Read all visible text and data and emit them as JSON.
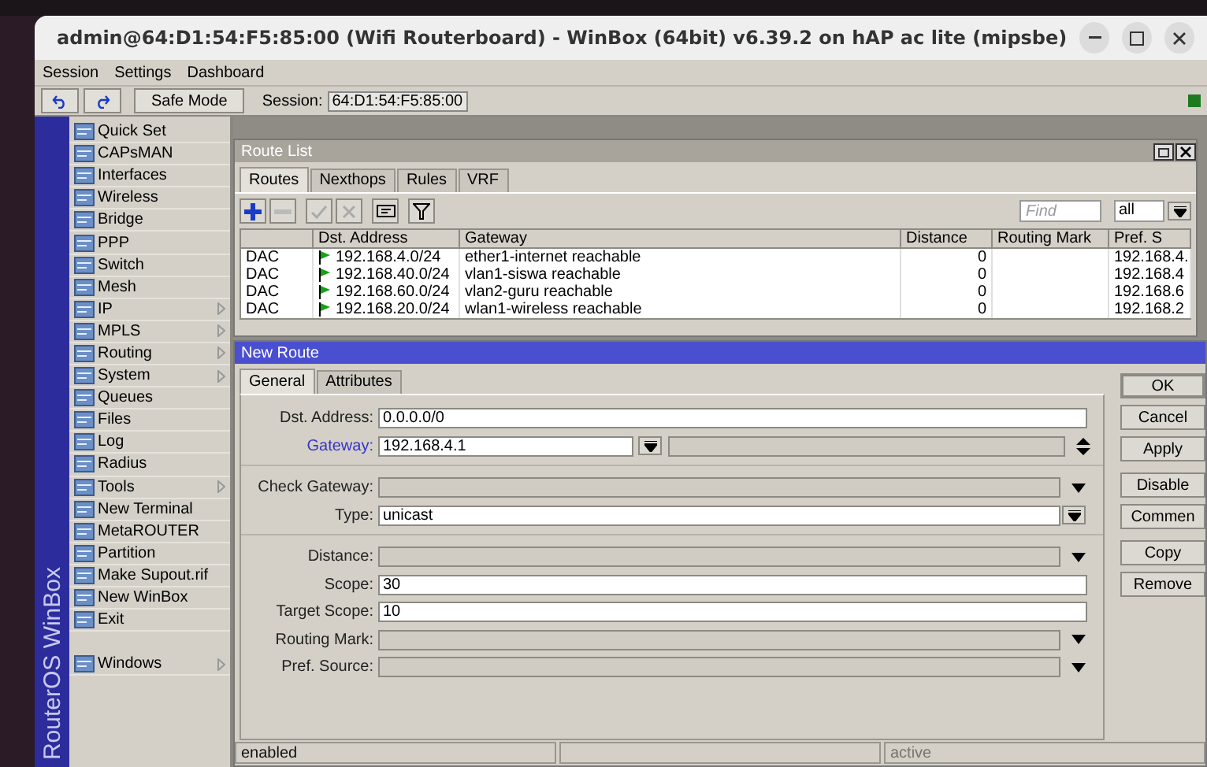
{
  "window": {
    "title": "admin@64:D1:54:F5:85:00 (Wifi Routerboard) - WinBox (64bit) v6.39.2 on hAP ac lite (mipsbe)"
  },
  "menu": [
    "Session",
    "Settings",
    "Dashboard"
  ],
  "toolbar": {
    "safe_mode": "Safe Mode",
    "session_label": "Session:",
    "session_value": "64:D1:54:F5:85:00"
  },
  "sidebar": {
    "brand": "RouterOS WinBox",
    "items": [
      {
        "label": "Quick Set",
        "submenu": false
      },
      {
        "label": "CAPsMAN",
        "submenu": false
      },
      {
        "label": "Interfaces",
        "submenu": false
      },
      {
        "label": "Wireless",
        "submenu": false
      },
      {
        "label": "Bridge",
        "submenu": false
      },
      {
        "label": "PPP",
        "submenu": false
      },
      {
        "label": "Switch",
        "submenu": false
      },
      {
        "label": "Mesh",
        "submenu": false
      },
      {
        "label": "IP",
        "submenu": true
      },
      {
        "label": "MPLS",
        "submenu": true
      },
      {
        "label": "Routing",
        "submenu": true
      },
      {
        "label": "System",
        "submenu": true
      },
      {
        "label": "Queues",
        "submenu": false
      },
      {
        "label": "Files",
        "submenu": false
      },
      {
        "label": "Log",
        "submenu": false
      },
      {
        "label": "Radius",
        "submenu": false
      },
      {
        "label": "Tools",
        "submenu": true
      },
      {
        "label": "New Terminal",
        "submenu": false
      },
      {
        "label": "MetaROUTER",
        "submenu": false
      },
      {
        "label": "Partition",
        "submenu": false
      },
      {
        "label": "Make Supout.rif",
        "submenu": false
      },
      {
        "label": "New WinBox",
        "submenu": false
      },
      {
        "label": "Exit",
        "submenu": false
      }
    ],
    "footer_items": [
      {
        "label": "Windows",
        "submenu": true
      }
    ]
  },
  "route_list": {
    "title": "Route List",
    "tabs": [
      {
        "label": "Routes",
        "selected": true
      },
      {
        "label": "Nexthops",
        "selected": false
      },
      {
        "label": "Rules",
        "selected": false
      },
      {
        "label": "VRF",
        "selected": false
      }
    ],
    "tools": [
      {
        "kind": "add",
        "disabled": false
      },
      {
        "kind": "remove",
        "disabled": true
      },
      {
        "kind": "enable",
        "disabled": true
      },
      {
        "kind": "disable",
        "disabled": true
      },
      {
        "kind": "comment",
        "disabled": false
      },
      {
        "kind": "filter",
        "disabled": false
      }
    ],
    "find_placeholder": "Find",
    "filter_value": "all",
    "columns": [
      "Dst. Address",
      "Gateway",
      "Distance",
      "Routing Mark",
      "Pref. S"
    ],
    "rows": [
      {
        "type": "DAC",
        "dst": "192.168.4.0/24",
        "gateway": "ether1-internet reachable",
        "distance": "0",
        "pref_source": "192.168.4."
      },
      {
        "type": "DAC",
        "dst": "192.168.40.0/24",
        "gateway": "vlan1-siswa reachable",
        "distance": "0",
        "pref_source": "192.168.4"
      },
      {
        "type": "DAC",
        "dst": "192.168.60.0/24",
        "gateway": "vlan2-guru reachable",
        "distance": "0",
        "pref_source": "192.168.6"
      },
      {
        "type": "DAC",
        "dst": "192.168.20.0/24",
        "gateway": "wlan1-wireless reachable",
        "distance": "0",
        "pref_source": "192.168.2"
      }
    ]
  },
  "new_route": {
    "title": "New Route",
    "tabs": [
      {
        "label": "General",
        "selected": true
      },
      {
        "label": "Attributes",
        "selected": false
      }
    ],
    "field_groups": [
      [
        {
          "label": "Dst. Address:",
          "kind": "text",
          "value": "0.0.0.0/0",
          "highlighted": false
        },
        {
          "label": "Gateway:",
          "kind": "gateway",
          "value": "192.168.4.1",
          "highlighted": true
        }
      ],
      [
        {
          "label": "Check Gateway:",
          "kind": "empty",
          "highlighted": false
        },
        {
          "label": "Type:",
          "kind": "select",
          "value": "unicast",
          "highlighted": false
        }
      ],
      [
        {
          "label": "Distance:",
          "kind": "empty",
          "highlighted": false
        },
        {
          "label": "Scope:",
          "kind": "text",
          "value": "30",
          "highlighted": false
        },
        {
          "label": "Target Scope:",
          "kind": "text",
          "value": "10",
          "highlighted": false
        },
        {
          "label": "Routing Mark:",
          "kind": "empty",
          "highlighted": false
        },
        {
          "label": "Pref. Source:",
          "kind": "empty",
          "highlighted": false
        }
      ]
    ],
    "buttons": [
      "OK",
      "Cancel",
      "Apply",
      "Disable",
      "Commen",
      "Copy",
      "Remove"
    ],
    "status": [
      {
        "text": "enabled",
        "disabled": false
      },
      {
        "text": "active",
        "disabled": true
      }
    ]
  }
}
